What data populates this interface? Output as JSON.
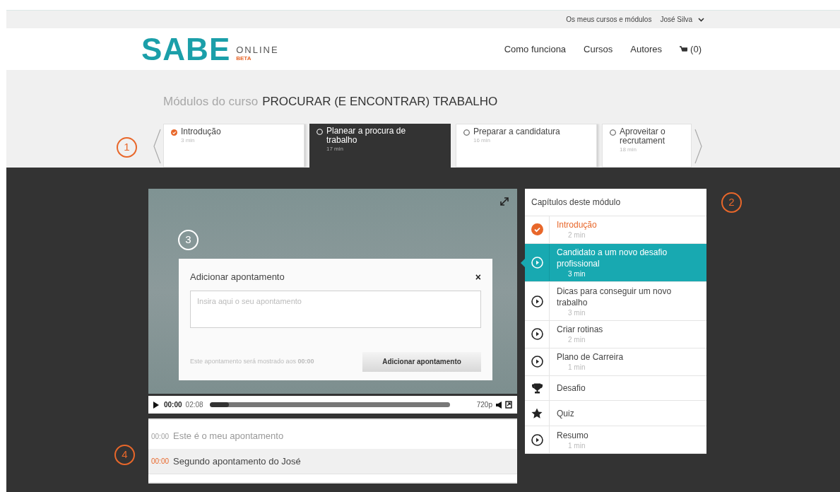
{
  "top_bar": {
    "links": [
      "Os meus cursos e módulos",
      "José Silva"
    ]
  },
  "header": {
    "logo": {
      "mark": "SABE",
      "word": "ONLINE",
      "badge": "BETA"
    },
    "nav": [
      "Como funciona",
      "Cursos",
      "Autores"
    ],
    "cart": "(0)"
  },
  "course": {
    "prefix": "Módulos do curso",
    "title": "PROCURAR (E ENCONTRAR) TRABALHO"
  },
  "modules": [
    {
      "title": "Introdução",
      "duration": "3 min",
      "completed": true,
      "selected": false
    },
    {
      "title": "Planear a procura de trabalho",
      "duration": "17 min",
      "completed": false,
      "selected": true
    },
    {
      "title": "Preparar a candidatura",
      "duration": "16 min",
      "completed": false,
      "selected": false
    },
    {
      "title": "Aproveitar o recrutament",
      "duration": "18 min",
      "completed": false,
      "selected": false
    }
  ],
  "annotations": [
    "1",
    "2",
    "3",
    "4"
  ],
  "video": {
    "current": "00:00",
    "total": "02:08",
    "level": 0.08,
    "quality": "720p"
  },
  "note_dialog": {
    "title": "Adicionar apontamento",
    "close": "×",
    "placeholder": "Insira aqui o seu apontamento",
    "hint": "Este apontamento será mostrado aos **00:00**",
    "button": "Adicionar apontamento"
  },
  "chapters": {
    "title": "Capítulos deste módulo",
    "items": [
      {
        "kind": "video",
        "title": "Introdução",
        "duration": "2 min",
        "completed": true,
        "selected": false
      },
      {
        "kind": "video",
        "title": "Candidato a um novo desafio profissional",
        "duration": "3 min",
        "completed": false,
        "selected": true
      },
      {
        "kind": "video",
        "title": "Dicas para conseguir um novo trabalho",
        "duration": "3 min",
        "completed": false,
        "selected": false
      },
      {
        "kind": "video",
        "title": "Criar rotinas",
        "duration": "2 min",
        "completed": false,
        "selected": false
      },
      {
        "kind": "video",
        "title": "Plano de Carreira",
        "duration": "1 min",
        "completed": false,
        "selected": false
      },
      {
        "kind": "trophy",
        "title": "Desafio",
        "completed": false,
        "selected": false
      },
      {
        "kind": "star",
        "title": "Quiz",
        "completed": false,
        "selected": false
      },
      {
        "kind": "video",
        "title": "Resumo",
        "duration": "1 min",
        "completed": false,
        "selected": false
      }
    ]
  },
  "notes": [
    {
      "time": "00:00",
      "text": "Este é o meu apontamento",
      "selected": false
    },
    {
      "time": "00:00",
      "text": "Segundo apontamento do José",
      "selected": true
    }
  ]
}
